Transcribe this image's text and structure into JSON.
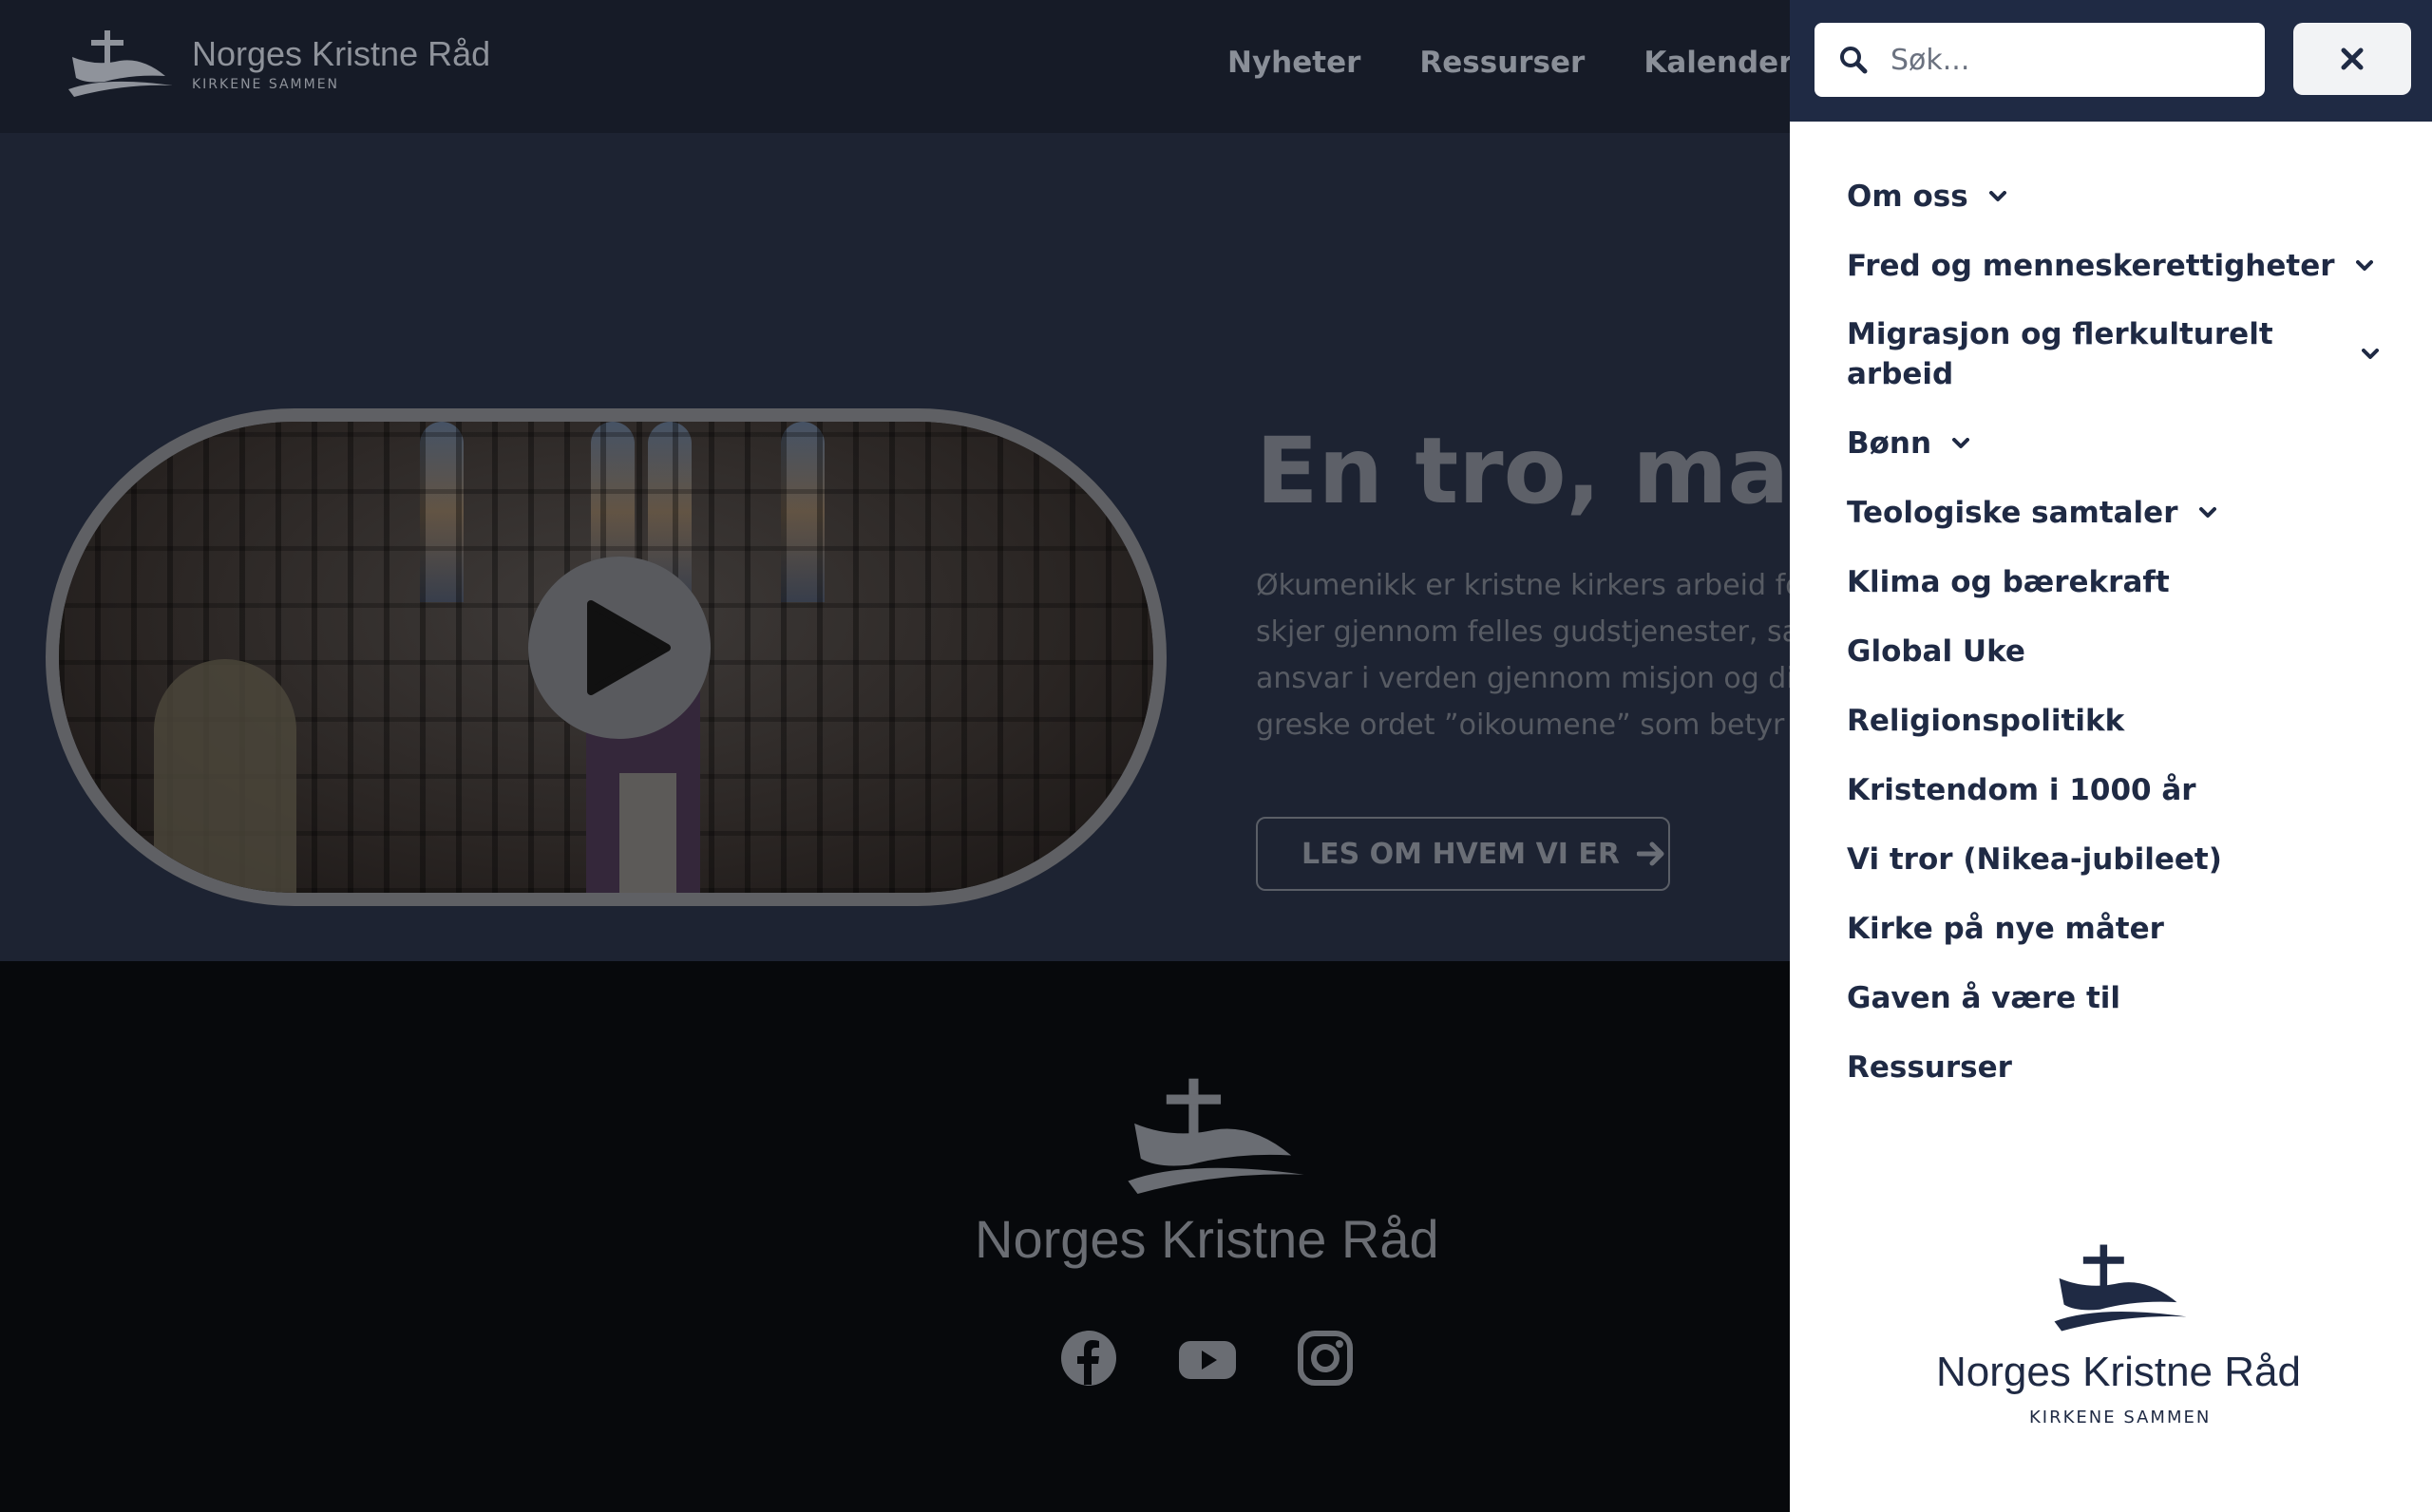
{
  "brand": {
    "name": "Norges Kristne Råd",
    "tagline": "KIRKENE SAMMEN"
  },
  "nav": {
    "items": [
      "Nyheter",
      "Ressurser",
      "Kalender"
    ]
  },
  "hero": {
    "title": "En tro, mange",
    "text_lines": [
      "Økumenikk er kristne kirkers arbeid for",
      "skjer gjennom felles gudstjenester, sam",
      "ansvar i verden gjennom misjon og diak",
      "greske ordet ”oikoumene” som betyr ”h"
    ],
    "cta_label": "LES OM HVEM VI ER"
  },
  "search": {
    "placeholder": "Søk..."
  },
  "menu": {
    "items": [
      {
        "label": "Om oss",
        "has_submenu": true
      },
      {
        "label": "Fred og menneskerettigheter",
        "has_submenu": true
      },
      {
        "label": "Migrasjon og flerkulturelt arbeid",
        "has_submenu": true
      },
      {
        "label": "Bønn",
        "has_submenu": true
      },
      {
        "label": "Teologiske samtaler",
        "has_submenu": true
      },
      {
        "label": "Klima og bærekraft",
        "has_submenu": false
      },
      {
        "label": "Global Uke",
        "has_submenu": false
      },
      {
        "label": "Religionspolitikk",
        "has_submenu": false
      },
      {
        "label": "Kristendom i 1000 år",
        "has_submenu": false
      },
      {
        "label": "Vi tror (Nikea-jubileet)",
        "has_submenu": false
      },
      {
        "label": "Kirke på nye måter",
        "has_submenu": false
      },
      {
        "label": "Gaven å være til",
        "has_submenu": false
      },
      {
        "label": "Ressurser",
        "has_submenu": false
      }
    ]
  },
  "footer": {
    "social_icons": [
      "facebook-icon",
      "youtube-icon",
      "instagram-icon"
    ]
  },
  "colors": {
    "navy": "#1f2a44",
    "overlay_bg": "#1d2332",
    "footer_bg": "#07090c"
  }
}
